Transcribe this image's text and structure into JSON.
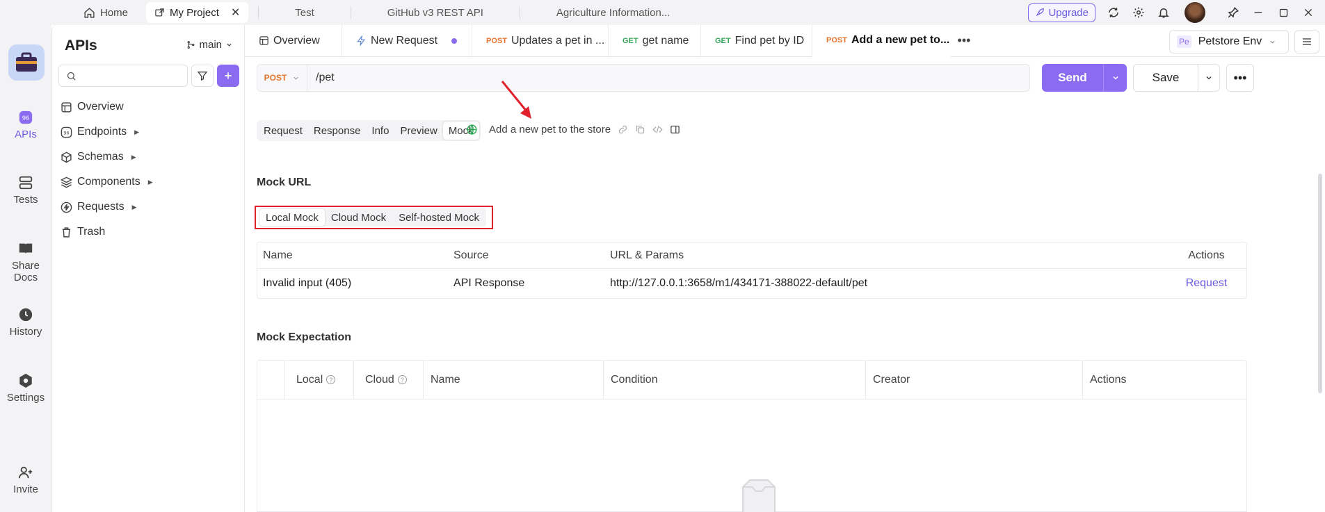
{
  "titlebar": {
    "home_label": "Home",
    "project_label": "My Project",
    "tabs": [
      "Test",
      "GitHub v3 REST API",
      "Agriculture Information..."
    ],
    "upgrade_label": "Upgrade"
  },
  "rail": {
    "items": [
      {
        "label": "APIs",
        "icon": "api-icon"
      },
      {
        "label": "Tests",
        "icon": "tests-icon"
      },
      {
        "label": "Share Docs",
        "icon": "book-icon"
      },
      {
        "label": "History",
        "icon": "clock-icon"
      },
      {
        "label": "Settings",
        "icon": "gear-icon"
      },
      {
        "label": "Invite",
        "icon": "add-user-icon"
      }
    ]
  },
  "sidebar": {
    "title": "APIs",
    "branch": "main",
    "search_placeholder": "",
    "nav": [
      "Overview",
      "Endpoints",
      "Schemas",
      "Components",
      "Requests",
      "Trash"
    ]
  },
  "tabs": {
    "overview": "Overview",
    "new_request": "New Request",
    "t3_method": "POST",
    "t3_label": "Updates a pet in ...",
    "t4_method": "GET",
    "t4_label": "get name",
    "t5_method": "GET",
    "t5_label": "Find pet by ID",
    "t6_method": "POST",
    "t6_label": "Add a new pet to...",
    "env_badge": "Pe",
    "env_label": "Petstore Env"
  },
  "request": {
    "method": "POST",
    "path": "/pet",
    "send_label": "Send",
    "save_label": "Save"
  },
  "subtabs": [
    "Request",
    "Response",
    "Info",
    "Preview",
    "Mock"
  ],
  "description": "Add a new pet to the store",
  "mock_url": {
    "title": "Mock URL",
    "tabs": [
      "Local Mock",
      "Cloud Mock",
      "Self-hosted Mock"
    ],
    "columns": [
      "Name",
      "Source",
      "URL & Params",
      "Actions"
    ],
    "rows": [
      {
        "name": "Invalid input (405)",
        "source": "API Response",
        "url": "http://127.0.0.1:3658/m1/434171-388022-default/pet",
        "action": "Request"
      }
    ]
  },
  "mock_expectation": {
    "title": "Mock Expectation",
    "columns": [
      "Local",
      "Cloud",
      "Name",
      "Condition",
      "Creator",
      "Actions"
    ]
  },
  "colors": {
    "accent": "#8b6cf1",
    "post": "#e8742c",
    "get": "#3aa55c",
    "annotation": "#e0202a"
  }
}
